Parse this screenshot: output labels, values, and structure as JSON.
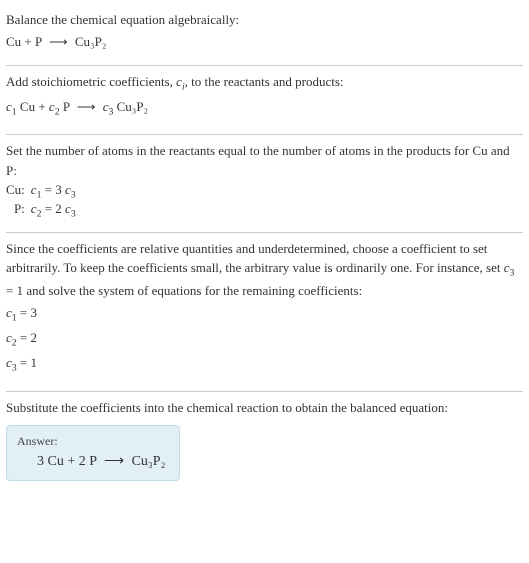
{
  "s1": {
    "l1": "Balance the chemical equation algebraically:",
    "eq_left": "Cu + P",
    "arrow": "⟶",
    "eq_right": "Cu₃P₂"
  },
  "s2": {
    "text_a": "Add stoichiometric coefficients, ",
    "ci": "c",
    "ci_sub": "i",
    "text_b": ", to the reactants and products:",
    "c1": "c",
    "c1s": "1",
    "t1": " Cu + ",
    "c2": "c",
    "c2s": "2",
    "t2": " P",
    "arrow": "⟶",
    "c3": "c",
    "c3s": "3",
    "t3": " Cu₃P₂"
  },
  "s3": {
    "l1": "Set the number of atoms in the reactants equal to the number of atoms in the products for Cu and P:",
    "rows": [
      {
        "label": "Cu:",
        "lhs_c": "c",
        "lhs_s": "1",
        "eq": " = 3 ",
        "rhs_c": "c",
        "rhs_s": "3"
      },
      {
        "label": "P:",
        "lhs_c": "c",
        "lhs_s": "2",
        "eq": " = 2 ",
        "rhs_c": "c",
        "rhs_s": "3"
      }
    ]
  },
  "s4": {
    "p_a": "Since the coefficients are relative quantities and underdetermined, choose a coefficient to set arbitrarily. To keep the coefficients small, the arbitrary value is ordinarily one. For instance, set ",
    "cv": "c",
    "cvs": "3",
    "p_b": " = 1 and solve the system of equations for the remaining coefficients:",
    "rows": [
      {
        "c": "c",
        "s": "1",
        "v": " = 3"
      },
      {
        "c": "c",
        "s": "2",
        "v": " = 2"
      },
      {
        "c": "c",
        "s": "3",
        "v": " = 1"
      }
    ]
  },
  "s5": {
    "l1": "Substitute the coefficients into the chemical reaction to obtain the balanced equation:",
    "answer_label": "Answer:",
    "eq_left": "3 Cu + 2 P",
    "arrow": "⟶",
    "eq_right": "Cu₃P₂"
  }
}
